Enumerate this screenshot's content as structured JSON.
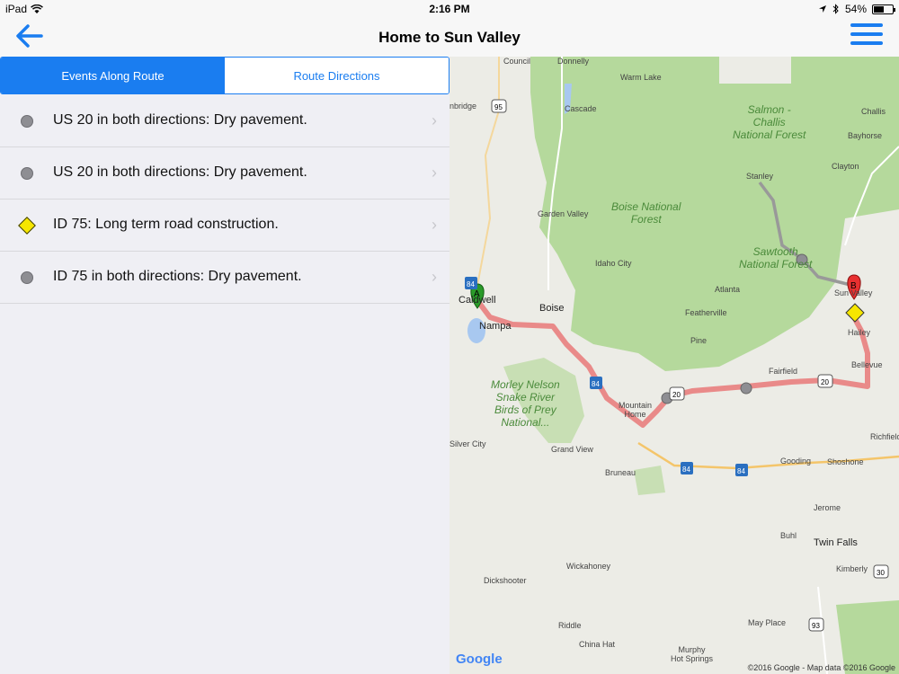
{
  "status_bar": {
    "device": "iPad",
    "time": "2:16 PM",
    "battery": "54%",
    "battery_level": 0.54
  },
  "nav": {
    "title": "Home to Sun Valley",
    "back_icon": "back-arrow-icon",
    "menu_icon": "hamburger-menu-icon"
  },
  "tabs": [
    {
      "label": "Events Along Route",
      "active": true
    },
    {
      "label": "Route Directions",
      "active": false
    }
  ],
  "events": [
    {
      "icon": "gray-circle-icon",
      "text": "US 20 in both directions: Dry pavement."
    },
    {
      "icon": "gray-circle-icon",
      "text": "US 20 in both directions: Dry pavement."
    },
    {
      "icon": "yellow-diamond-icon",
      "text": "ID 75: Long term road construction."
    },
    {
      "icon": "gray-circle-icon",
      "text": "ID 75 in both directions: Dry pavement."
    }
  ],
  "map": {
    "labels": {
      "council": "Council",
      "donnelly": "Donnelly",
      "warm_lake": "Warm Lake",
      "cascade": "Cascade",
      "salmon": "Salmon -\nChallis\nNational Forest",
      "challis": "Challis",
      "bayhorse": "Bayhorse",
      "clayton": "Clayton",
      "stanley": "Stanley",
      "boise_nf": "Boise National\nForest",
      "garden_valley": "Garden Valley",
      "sawtooth": "Sawtooth\nNational Forest",
      "idaho_city": "Idaho City",
      "atlanta": "Atlanta",
      "caldwell": "Caldwell",
      "boise": "Boise",
      "sun_valley": "Sun Valley",
      "nampa": "Nampa",
      "featherville": "Featherville",
      "hailey": "Hailey",
      "pine": "Pine",
      "bellevue": "Bellevue",
      "fairfield": "Fairfield",
      "morley": "Morley Nelson\nSnake River\nBirds of Prey\nNational...",
      "mountain_home": "Mountain\nHome",
      "silver_city": "Silver City",
      "grand_view": "Grand View",
      "richfield": "Richfield",
      "bruneau": "Bruneau",
      "gooding": "Gooding",
      "shoshone": "Shoshone",
      "jerome": "Jerome",
      "buhl": "Buhl",
      "twin_falls": "Twin Falls",
      "kimberly": "Kimberly",
      "wickahoney": "Wickahoney",
      "dickshooter": "Dickshooter",
      "riddle": "Riddle",
      "may_place": "May Place",
      "china_hat": "China Hat",
      "murphy": "Murphy\nHot Springs",
      "bridge": "nbridge"
    },
    "shields": [
      "95",
      "84",
      "84",
      "20",
      "20",
      "84",
      "84",
      "93",
      "30"
    ],
    "marker_a": "A",
    "marker_b": "B",
    "logo": "Google",
    "copyright": "©2016 Google - Map data ©2016 Google",
    "colors": {
      "forest": "#b5d99c",
      "route": "#e86a6a",
      "land": "#ecece6",
      "accent": "#1a7df0"
    }
  }
}
